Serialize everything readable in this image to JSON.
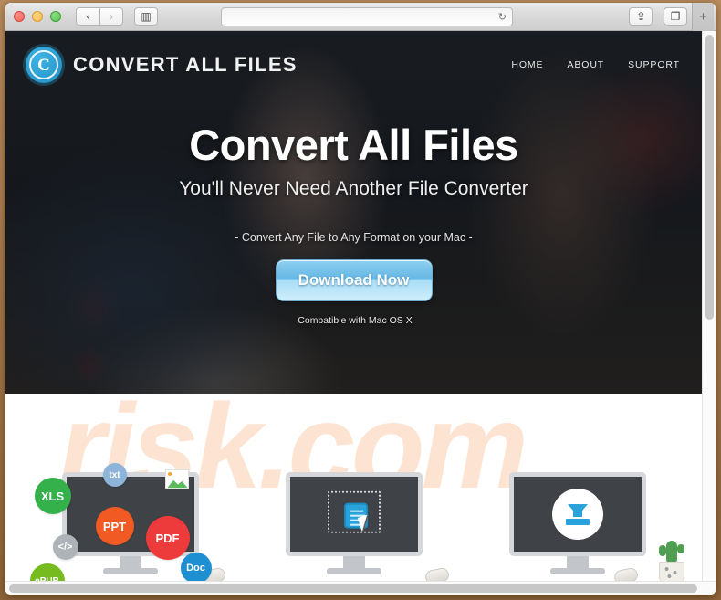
{
  "browser": {
    "traffic_lights": [
      "close",
      "minimize",
      "zoom"
    ],
    "back_label": "‹",
    "forward_label": "›",
    "sidebar_icon": "▥",
    "url_value": "",
    "url_placeholder": "",
    "reload_icon": "↻",
    "share_icon": "⇪",
    "tabs_icon": "❐",
    "new_tab_label": "+"
  },
  "site": {
    "logo_letter": "C",
    "logo_text": "CONVERT ALL FILES",
    "nav": [
      {
        "label": "HOME"
      },
      {
        "label": "ABOUT"
      },
      {
        "label": "SUPPORT"
      }
    ]
  },
  "hero": {
    "headline": "Convert All Files",
    "subheadline": "You'll Never Need Another File Converter",
    "tagline": "- Convert Any File to Any Format on your Mac -",
    "cta_label": "Download Now",
    "apple_glyph": "",
    "compatibility": "Compatible with Mac OS X"
  },
  "features": {
    "watermark": "risk.com",
    "file_badges": [
      {
        "label": "XLS",
        "color": "#34b14a"
      },
      {
        "label": "txt",
        "color": "#8fb4d9"
      },
      {
        "label": "PPT",
        "color": "#f15a22"
      },
      {
        "label": "PDF",
        "color": "#ed3b3b"
      },
      {
        "label": "Doc",
        "color": "#1e8fd0"
      },
      {
        "label": "ePUB",
        "color": "#76bc21"
      },
      {
        "label": "</>",
        "color": "#aeb3b8"
      }
    ],
    "items": [
      {
        "name": "file-formats"
      },
      {
        "name": "select-file"
      },
      {
        "name": "download"
      }
    ]
  },
  "colors": {
    "accent_blue": "#29a3d9",
    "watermark": "#fce3d2",
    "screen_dark": "#3f4246"
  }
}
